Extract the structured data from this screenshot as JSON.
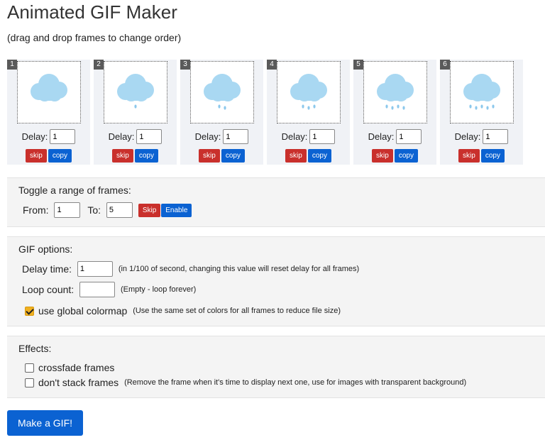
{
  "title": "Animated GIF Maker",
  "subtitle": "(drag and drop frames to change order)",
  "frames": [
    {
      "number": "1",
      "delay_label": "Delay:",
      "delay": "1",
      "skip": "skip",
      "copy": "copy",
      "drops": 0
    },
    {
      "number": "2",
      "delay_label": "Delay:",
      "delay": "1",
      "skip": "skip",
      "copy": "copy",
      "drops": 1
    },
    {
      "number": "3",
      "delay_label": "Delay:",
      "delay": "1",
      "skip": "skip",
      "copy": "copy",
      "drops": 2
    },
    {
      "number": "4",
      "delay_label": "Delay:",
      "delay": "1",
      "skip": "skip",
      "copy": "copy",
      "drops": 3
    },
    {
      "number": "5",
      "delay_label": "Delay:",
      "delay": "1",
      "skip": "skip",
      "copy": "copy",
      "drops": 4
    },
    {
      "number": "6",
      "delay_label": "Delay:",
      "delay": "1",
      "skip": "skip",
      "copy": "copy",
      "drops": 5
    }
  ],
  "toggle_range": {
    "title": "Toggle a range of frames:",
    "from_label": "From:",
    "from_value": "1",
    "to_label": "To:",
    "to_value": "5",
    "skip": "Skip",
    "enable": "Enable"
  },
  "gif_options": {
    "title": "GIF options:",
    "delay_label": "Delay time:",
    "delay_value": "1",
    "delay_hint": "(in 1/100 of second, changing this value will reset delay for all frames)",
    "loop_label": "Loop count:",
    "loop_value": "",
    "loop_hint": "(Empty - loop forever)",
    "colormap_label": "use global colormap",
    "colormap_hint": "(Use the same set of colors for all frames to reduce file size)",
    "colormap_checked": true
  },
  "effects": {
    "title": "Effects:",
    "crossfade_label": "crossfade frames",
    "crossfade_checked": false,
    "nostack_label": "don't stack frames",
    "nostack_hint": "(Remove the frame when it's time to display next one, use for images with transparent background)",
    "nostack_checked": false
  },
  "make_button": "Make a GIF!",
  "colors": {
    "cloud": "#a9d8f2",
    "drop": "#8cc8ec",
    "skip_red": "#c9302c",
    "primary_blue": "#0b62d2",
    "checkbox_accent": "#f0b020"
  }
}
